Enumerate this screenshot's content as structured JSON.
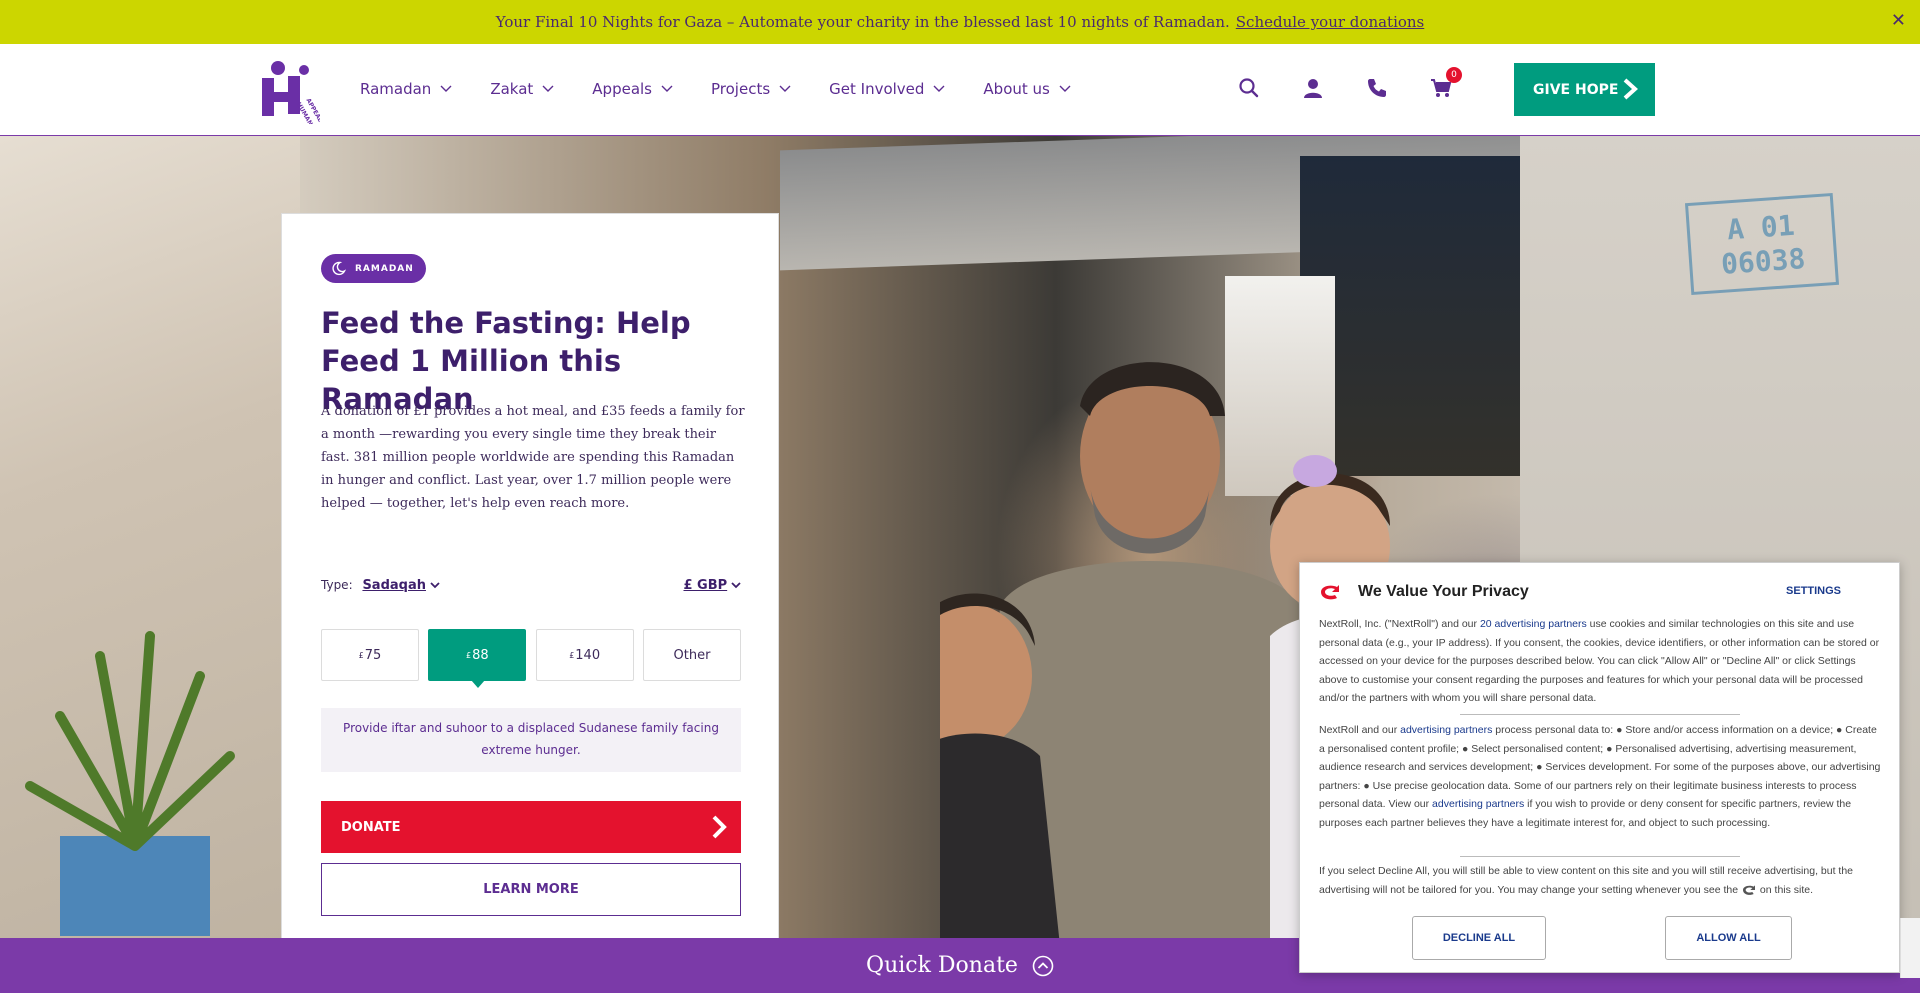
{
  "announcement": {
    "text": "Your Final 10 Nights for Gaza – Automate your charity in the blessed last 10 nights of Ramadan.",
    "link": "Schedule your donations",
    "close": "✕"
  },
  "header": {
    "logo_text": "HUMAN APPEAL",
    "nav": [
      "Ramadan",
      "Zakat",
      "Appeals",
      "Projects",
      "Get Involved",
      "About us"
    ],
    "cart_count": "0",
    "give_hope": "GIVE HOPE"
  },
  "hero": {
    "stamp": "A 01\n06038"
  },
  "card": {
    "tag": "RAMADAN",
    "title": "Feed the Fasting: Help Feed 1 Million this Ramadan",
    "description": "A donation of £1 provides a hot meal, and £35 feeds a family for a month —rewarding you every single time they break their fast. 381 million people worldwide are spending this Ramadan in hunger and conflict. Last year, over 1.7 million people were helped — together, let's help even reach more.",
    "type_label": "Type:",
    "type_value": "Sadaqah",
    "currency": "£ GBP",
    "currency_symbol": "£",
    "amounts": [
      "75",
      "88",
      "140"
    ],
    "other_label": "Other",
    "selected_amount": "88",
    "impact_text": "Provide iftar and suhoor to a displaced Sudanese family facing extreme hunger.",
    "donate_label": "DONATE",
    "learn_more_label": "LEARN MORE"
  },
  "quick_donate": "Quick Donate",
  "privacy": {
    "title": "We Value Your Privacy",
    "settings": "SETTINGS",
    "p1_a": "NextRoll, Inc. (\"NextRoll\") and our ",
    "p1_link": "20 advertising partners",
    "p1_b": " use cookies and similar technologies on this site and use personal data (e.g., your IP address). If you consent, the cookies, device identifiers, or other information can be stored or accessed on your device for the purposes described below. You can click \"Allow All\" or \"Decline All\" or click Settings above to customise your consent regarding the purposes and features for which your personal data will be processed and/or the partners with whom you will share personal data.",
    "p2_a": "NextRoll and our ",
    "p2_link1": "advertising partners",
    "p2_b": " process personal data to: ● Store and/or access information on a device; ● Create a personalised content profile; ● Select personalised content; ● Personalised advertising, advertising measurement, audience research and services development; ● Services development. For some of the purposes above, our advertising partners: ● Use precise geolocation data. Some of our partners rely on their legitimate business interests to process personal data. View our ",
    "p2_link2": "advertising partners",
    "p2_c": " if you wish to provide or deny consent for specific partners, review the purposes each partner believes they have a legitimate interest for, and object to such processing.",
    "p3_a": "If you select Decline All, you will still be able to view content on this site and you will still receive advertising, but the advertising will not be tailored for you. You may change your setting whenever you see the ",
    "p3_b": " on this site.",
    "decline": "DECLINE ALL",
    "allow": "ALLOW ALL"
  },
  "colors": {
    "announcement_bg": "#ccd600",
    "brand_purple": "#5c2d91",
    "give_hope_green": "#009c7f",
    "donate_red": "#e4122e",
    "quick_donate_bg": "#7b3aa8"
  }
}
